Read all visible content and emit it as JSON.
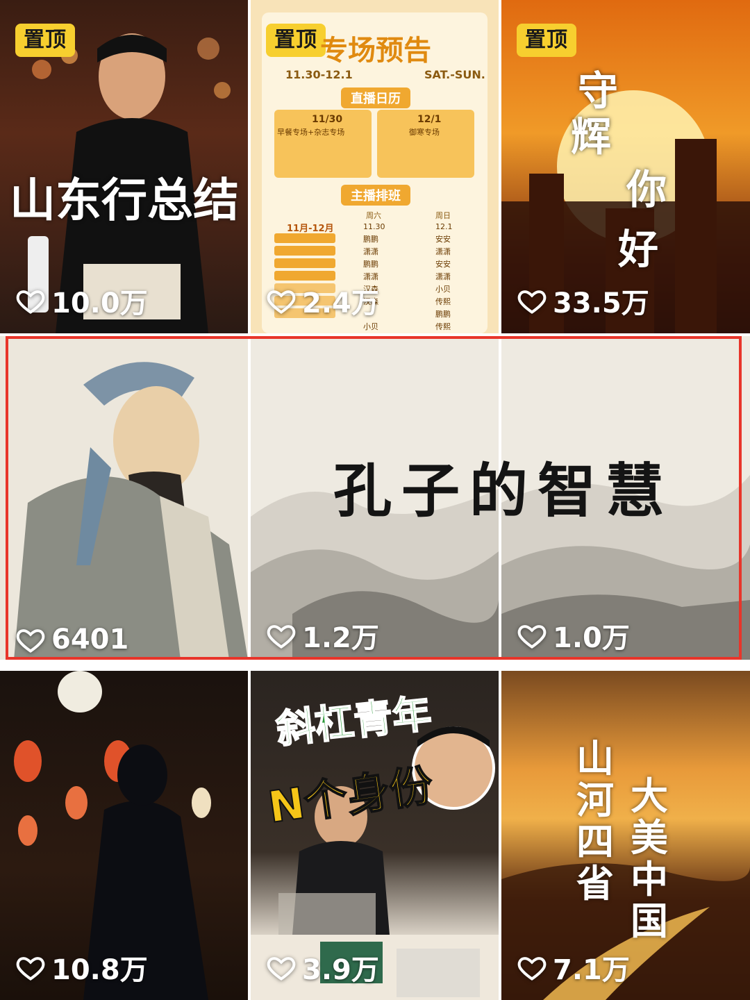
{
  "grid": {
    "row1": [
      {
        "pin": "置顶",
        "title": "山东行总结",
        "likes": "10.0万"
      },
      {
        "pin": "置顶",
        "title": "专场预告",
        "date_range": "11.30-12.1",
        "weekday": "SAT.-SUN.",
        "section_calendar": "直播日历",
        "day1_date": "11/30",
        "day1_name": "早餐专场+杂志专场",
        "day2_date": "12/1",
        "day2_name": "御寒专场",
        "section_schedule": "主播排班",
        "col_header_1": "周六",
        "col_header_2": "周日",
        "month_label": "11月-12月",
        "col_date_1": "11.30",
        "col_date_2": "12.1",
        "hosts_sat": [
          "鹏鹏",
          "潇潇",
          "鹏鹏",
          "潇潇",
          "汉森",
          "汉森",
          "小贝"
        ],
        "hosts_sun": [
          "安安",
          "潇潇",
          "安安",
          "潇潇",
          "小贝",
          "传熙",
          "鹏鹏",
          "传熙"
        ],
        "likes": "2.4万"
      },
      {
        "pin": "置顶",
        "title_chars": [
          "守",
          "辉",
          "你",
          "好"
        ],
        "likes": "33.5万"
      }
    ],
    "row2": {
      "title": "孔子的智慧",
      "likes": [
        "6401",
        "1.2万",
        "1.0万"
      ]
    },
    "row3": [
      {
        "likes": "10.8万"
      },
      {
        "title_line1": "斜杠青年",
        "title_line2": "N个身份",
        "likes": "3.9万"
      },
      {
        "title_col1": "山河四省",
        "title_col2": "大美中国",
        "likes": "7.1万"
      }
    ]
  },
  "colors": {
    "pin_bg": "#f7cf2f",
    "highlight_border": "#e8352a"
  },
  "icons": {
    "like": "heart-outline-icon"
  }
}
